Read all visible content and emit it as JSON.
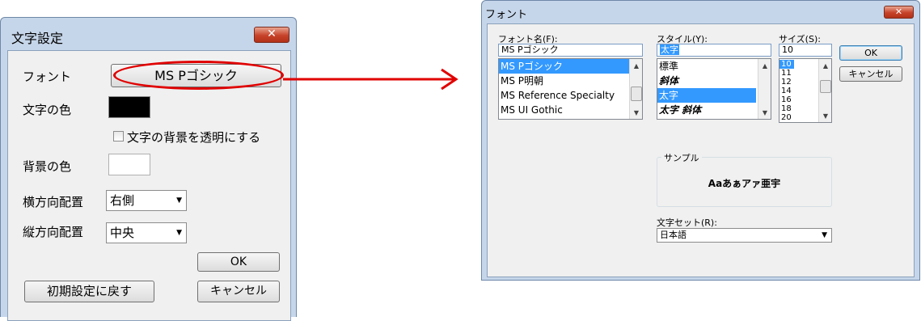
{
  "dialog_left": {
    "title": "文字設定",
    "close_glyph": "✕",
    "font_label": "フォント",
    "font_button": "MS Pゴシック",
    "text_color_label": "文字の色",
    "text_color": "#000000",
    "transparent_checkbox_label": "文字の背景を透明にする",
    "bg_color_label": "背景の色",
    "bg_color": "#ffffff",
    "h_align_label": "横方向配置",
    "h_align_value": "右側",
    "v_align_label": "縦方向配置",
    "v_align_value": "中央",
    "ok_label": "OK",
    "reset_label": "初期設定に戻す",
    "cancel_label": "キャンセル"
  },
  "arrow_color": "#e00000",
  "dialog_right": {
    "title": "フォント",
    "close_glyph": "✕",
    "font_name_label": "フォント名(F):",
    "font_name_value": "MS Pゴシック",
    "font_list": [
      "MS Pゴシック",
      "MS P明朝",
      "MS Reference Specialty",
      "MS UI Gothic"
    ],
    "style_label": "スタイル(Y):",
    "style_value": "太字",
    "style_list": [
      "標準",
      "斜体",
      "太字",
      "太字 斜体"
    ],
    "size_label": "サイズ(S):",
    "size_value": "10",
    "size_list": [
      "10",
      "11",
      "12",
      "14",
      "16",
      "18",
      "20"
    ],
    "ok_label": "OK",
    "cancel_label": "キャンセル",
    "sample_label": "サンプル",
    "sample_text": "Aaあぁアァ亜宇",
    "charset_label": "文字セット(R):",
    "charset_value": "日本語"
  }
}
